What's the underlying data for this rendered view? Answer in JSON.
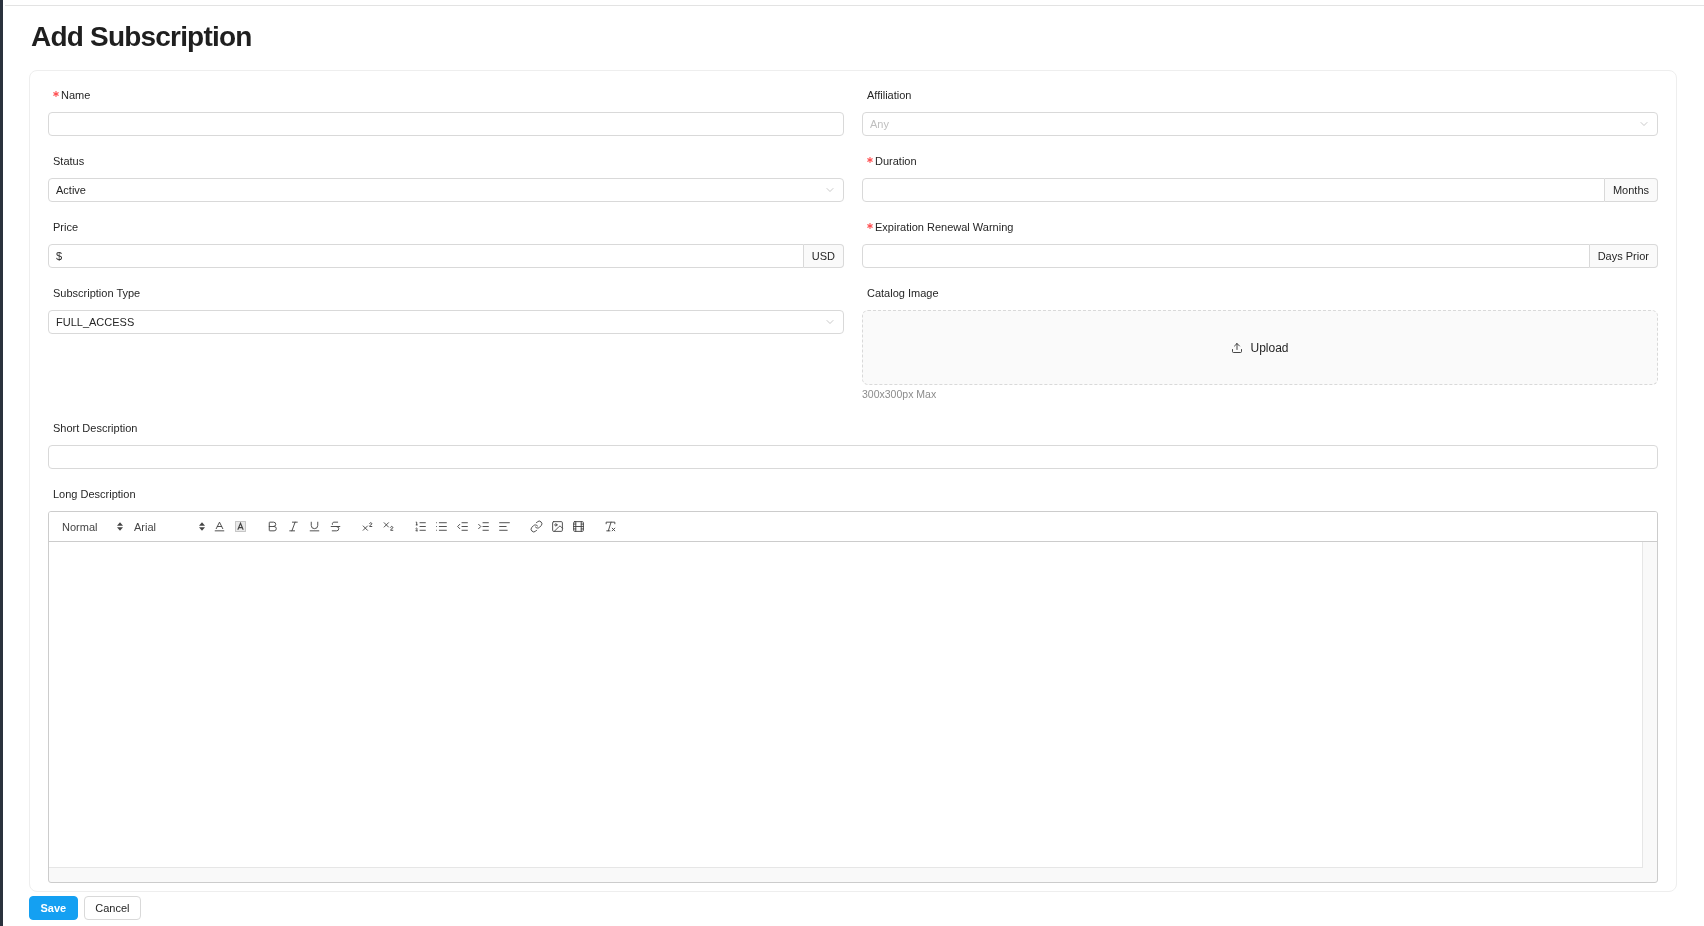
{
  "page_title": "Add Subscription",
  "form": {
    "left_column": [
      {
        "kind": "text",
        "label": "Name",
        "required": true
      },
      {
        "kind": "select",
        "label": "Status",
        "required": false,
        "value": "Active"
      },
      {
        "kind": "addon",
        "label": "Price",
        "required": false,
        "value": "$",
        "addon": "USD"
      },
      {
        "kind": "select",
        "label": "Subscription Type",
        "required": false,
        "value": "FULL_ACCESS"
      }
    ],
    "right_column": [
      {
        "kind": "select",
        "label": "Affiliation",
        "required": false,
        "placeholder": "Any"
      },
      {
        "kind": "addon",
        "label": "Duration",
        "required": true,
        "addon": "Months"
      },
      {
        "kind": "addon",
        "label": "Expiration Renewal Warning",
        "required": true,
        "addon": "Days Prior"
      },
      {
        "kind": "upload",
        "label": "Catalog Image",
        "required": false,
        "button": "Upload",
        "hint": "300x300px Max"
      }
    ],
    "full_width": [
      {
        "kind": "text",
        "label": "Short Description",
        "required": false
      },
      {
        "kind": "rich_text",
        "label": "Long Description",
        "required": false,
        "toolbar": {
          "heading": "Normal",
          "font": "Arial"
        }
      }
    ]
  },
  "actions": [
    {
      "kind": "primary",
      "label": "Save"
    },
    {
      "kind": "default",
      "label": "Cancel"
    }
  ]
}
